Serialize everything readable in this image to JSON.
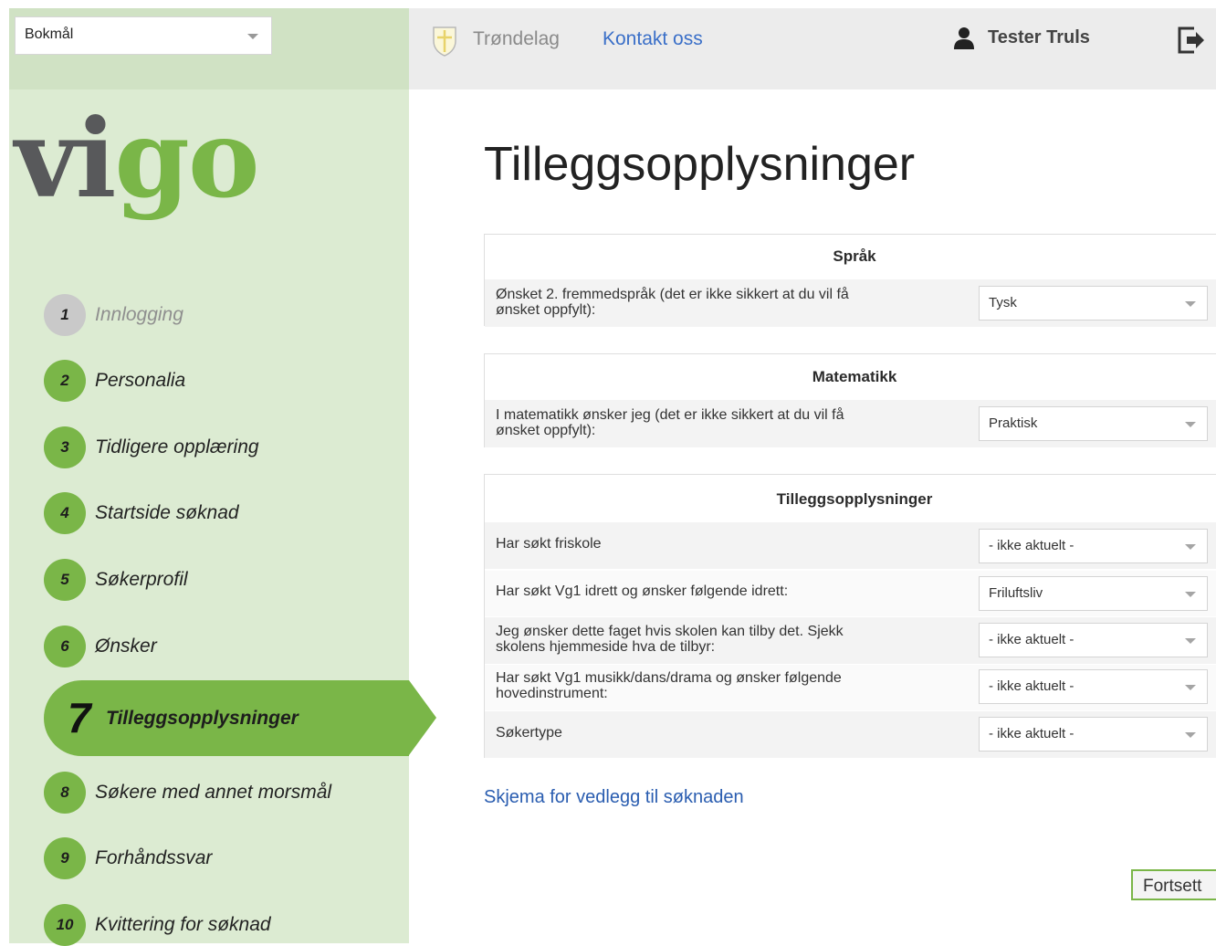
{
  "language_select": {
    "value": "Bokmål"
  },
  "logo": {
    "part1": "vi",
    "part2": "go"
  },
  "topbar": {
    "region": "Trøndelag",
    "contact": "Kontakt oss",
    "user": "Tester Truls",
    "icons": [
      "shield-icon",
      "user-icon",
      "logout-icon"
    ]
  },
  "steps": [
    {
      "num": "1",
      "label": "Innlogging"
    },
    {
      "num": "2",
      "label": "Personalia"
    },
    {
      "num": "3",
      "label": "Tidligere opplæring"
    },
    {
      "num": "4",
      "label": "Startside søknad"
    },
    {
      "num": "5",
      "label": "Søkerprofil"
    },
    {
      "num": "6",
      "label": "Ønsker"
    },
    {
      "num": "7",
      "label": "Tilleggsopplysninger"
    },
    {
      "num": "8",
      "label": "Søkere med annet morsmål"
    },
    {
      "num": "9",
      "label": "Forhåndssvar"
    },
    {
      "num": "10",
      "label": "Kvittering for søknad"
    }
  ],
  "main": {
    "title": "Tilleggsopplysninger",
    "sprak": {
      "heading": "Språk",
      "question_line1": "Ønsket 2. fremmedspråk (det er ikke sikkert at du vil få",
      "question_line2": "ønsket oppfylt):",
      "value": "Tysk"
    },
    "matematikk": {
      "heading": "Matematikk",
      "question_line1": "I matematikk ønsker jeg (det er ikke sikkert at du vil få",
      "question_line2": "ønsket oppfylt):",
      "value": "Praktisk"
    },
    "tillegg": {
      "heading": "Tilleggsopplysninger",
      "rows": [
        {
          "line1": "Har søkt friskole",
          "line2": "",
          "value": "- ikke aktuelt -"
        },
        {
          "line1": "Har søkt Vg1 idrett og ønsker følgende idrett:",
          "line2": "",
          "value": "Friluftsliv"
        },
        {
          "line1": "Jeg ønsker dette faget hvis skolen kan tilby det. Sjekk",
          "line2": "skolens hjemmeside hva de tilbyr:",
          "value": "- ikke aktuelt -"
        },
        {
          "line1": "Har søkt Vg1 musikk/dans/drama og ønsker følgende",
          "line2": "hovedinstrument:",
          "value": "- ikke aktuelt -"
        },
        {
          "line1": "Søkertype",
          "line2": "",
          "value": "- ikke aktuelt -"
        }
      ]
    },
    "attachment_link": "Skjema for vedlegg til søknaden",
    "continue_button": "Fortsett"
  }
}
